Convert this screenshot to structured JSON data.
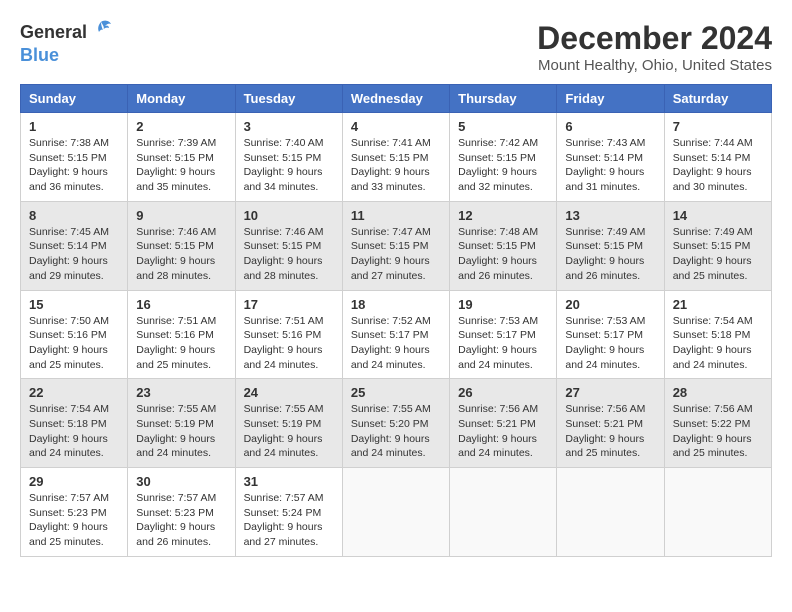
{
  "header": {
    "logo_general": "General",
    "logo_blue": "Blue",
    "title": "December 2024",
    "location": "Mount Healthy, Ohio, United States"
  },
  "calendar": {
    "columns": [
      "Sunday",
      "Monday",
      "Tuesday",
      "Wednesday",
      "Thursday",
      "Friday",
      "Saturday"
    ],
    "weeks": [
      [
        {
          "day": "1",
          "sunrise": "7:38 AM",
          "sunset": "5:15 PM",
          "daylight": "9 hours and 36 minutes."
        },
        {
          "day": "2",
          "sunrise": "7:39 AM",
          "sunset": "5:15 PM",
          "daylight": "9 hours and 35 minutes."
        },
        {
          "day": "3",
          "sunrise": "7:40 AM",
          "sunset": "5:15 PM",
          "daylight": "9 hours and 34 minutes."
        },
        {
          "day": "4",
          "sunrise": "7:41 AM",
          "sunset": "5:15 PM",
          "daylight": "9 hours and 33 minutes."
        },
        {
          "day": "5",
          "sunrise": "7:42 AM",
          "sunset": "5:15 PM",
          "daylight": "9 hours and 32 minutes."
        },
        {
          "day": "6",
          "sunrise": "7:43 AM",
          "sunset": "5:14 PM",
          "daylight": "9 hours and 31 minutes."
        },
        {
          "day": "7",
          "sunrise": "7:44 AM",
          "sunset": "5:14 PM",
          "daylight": "9 hours and 30 minutes."
        }
      ],
      [
        {
          "day": "8",
          "sunrise": "7:45 AM",
          "sunset": "5:14 PM",
          "daylight": "9 hours and 29 minutes."
        },
        {
          "day": "9",
          "sunrise": "7:46 AM",
          "sunset": "5:15 PM",
          "daylight": "9 hours and 28 minutes."
        },
        {
          "day": "10",
          "sunrise": "7:46 AM",
          "sunset": "5:15 PM",
          "daylight": "9 hours and 28 minutes."
        },
        {
          "day": "11",
          "sunrise": "7:47 AM",
          "sunset": "5:15 PM",
          "daylight": "9 hours and 27 minutes."
        },
        {
          "day": "12",
          "sunrise": "7:48 AM",
          "sunset": "5:15 PM",
          "daylight": "9 hours and 26 minutes."
        },
        {
          "day": "13",
          "sunrise": "7:49 AM",
          "sunset": "5:15 PM",
          "daylight": "9 hours and 26 minutes."
        },
        {
          "day": "14",
          "sunrise": "7:49 AM",
          "sunset": "5:15 PM",
          "daylight": "9 hours and 25 minutes."
        }
      ],
      [
        {
          "day": "15",
          "sunrise": "7:50 AM",
          "sunset": "5:16 PM",
          "daylight": "9 hours and 25 minutes."
        },
        {
          "day": "16",
          "sunrise": "7:51 AM",
          "sunset": "5:16 PM",
          "daylight": "9 hours and 25 minutes."
        },
        {
          "day": "17",
          "sunrise": "7:51 AM",
          "sunset": "5:16 PM",
          "daylight": "9 hours and 24 minutes."
        },
        {
          "day": "18",
          "sunrise": "7:52 AM",
          "sunset": "5:17 PM",
          "daylight": "9 hours and 24 minutes."
        },
        {
          "day": "19",
          "sunrise": "7:53 AM",
          "sunset": "5:17 PM",
          "daylight": "9 hours and 24 minutes."
        },
        {
          "day": "20",
          "sunrise": "7:53 AM",
          "sunset": "5:17 PM",
          "daylight": "9 hours and 24 minutes."
        },
        {
          "day": "21",
          "sunrise": "7:54 AM",
          "sunset": "5:18 PM",
          "daylight": "9 hours and 24 minutes."
        }
      ],
      [
        {
          "day": "22",
          "sunrise": "7:54 AM",
          "sunset": "5:18 PM",
          "daylight": "9 hours and 24 minutes."
        },
        {
          "day": "23",
          "sunrise": "7:55 AM",
          "sunset": "5:19 PM",
          "daylight": "9 hours and 24 minutes."
        },
        {
          "day": "24",
          "sunrise": "7:55 AM",
          "sunset": "5:19 PM",
          "daylight": "9 hours and 24 minutes."
        },
        {
          "day": "25",
          "sunrise": "7:55 AM",
          "sunset": "5:20 PM",
          "daylight": "9 hours and 24 minutes."
        },
        {
          "day": "26",
          "sunrise": "7:56 AM",
          "sunset": "5:21 PM",
          "daylight": "9 hours and 24 minutes."
        },
        {
          "day": "27",
          "sunrise": "7:56 AM",
          "sunset": "5:21 PM",
          "daylight": "9 hours and 25 minutes."
        },
        {
          "day": "28",
          "sunrise": "7:56 AM",
          "sunset": "5:22 PM",
          "daylight": "9 hours and 25 minutes."
        }
      ],
      [
        {
          "day": "29",
          "sunrise": "7:57 AM",
          "sunset": "5:23 PM",
          "daylight": "9 hours and 25 minutes."
        },
        {
          "day": "30",
          "sunrise": "7:57 AM",
          "sunset": "5:23 PM",
          "daylight": "9 hours and 26 minutes."
        },
        {
          "day": "31",
          "sunrise": "7:57 AM",
          "sunset": "5:24 PM",
          "daylight": "9 hours and 27 minutes."
        },
        null,
        null,
        null,
        null
      ]
    ]
  }
}
